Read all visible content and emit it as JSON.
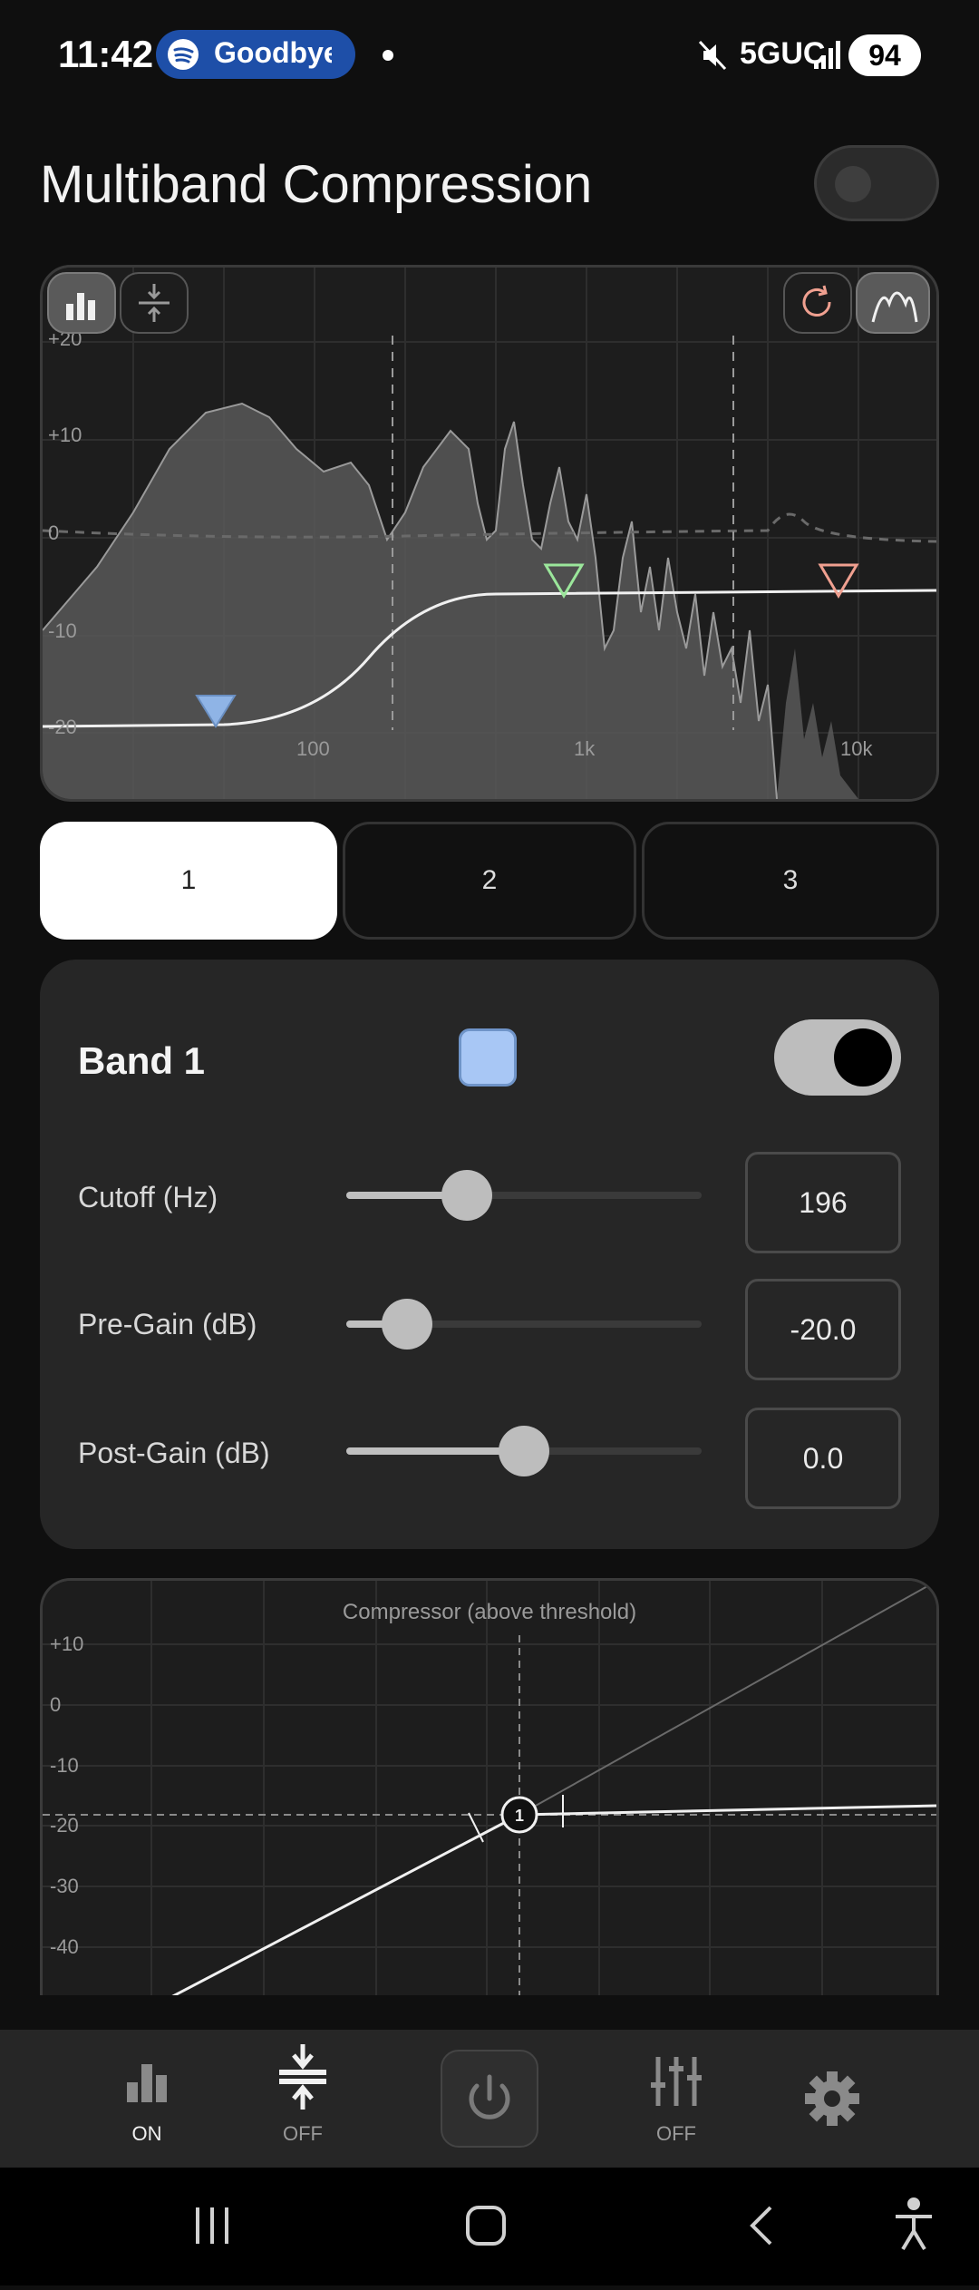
{
  "status_bar": {
    "time": "11:42",
    "media_title": "Goodbye",
    "network": "5GUC",
    "battery": "94"
  },
  "title": "Multiband Compression",
  "master_enabled": false,
  "eq_graph": {
    "y_ticks": [
      "+20",
      "+10",
      "0",
      "-10",
      "-20"
    ],
    "x_ticks": [
      "100",
      "1k",
      "10k"
    ],
    "band_markers": [
      {
        "band": "1",
        "color": "#8fb4e6"
      },
      {
        "band": "2",
        "color": "#9be69b"
      },
      {
        "band": "3",
        "color": "#f0a090"
      }
    ]
  },
  "tabs": [
    {
      "label": "1",
      "selected": true
    },
    {
      "label": "2",
      "selected": false
    },
    {
      "label": "3",
      "selected": false
    }
  ],
  "band": {
    "title": "Band 1",
    "color": "#a8c7f5",
    "enabled": true,
    "params": [
      {
        "label": "Cutoff (Hz)",
        "value": "196",
        "slider_fraction": 0.34
      },
      {
        "label": "Pre-Gain (dB)",
        "value": "-20.0",
        "slider_fraction": 0.17
      },
      {
        "label": "Post-Gain (dB)",
        "value": "0.0",
        "slider_fraction": 0.5
      }
    ]
  },
  "compressor_graph": {
    "title": "Compressor (above threshold)",
    "y_ticks": [
      "+10",
      "0",
      "-10",
      "-20",
      "-30",
      "-40"
    ],
    "marker_label": "1"
  },
  "bottom_nav": [
    {
      "name": "eq",
      "label": "ON"
    },
    {
      "name": "compressor",
      "label": "OFF"
    },
    {
      "name": "power",
      "label": ""
    },
    {
      "name": "mixer",
      "label": "OFF"
    },
    {
      "name": "settings",
      "label": ""
    }
  ]
}
